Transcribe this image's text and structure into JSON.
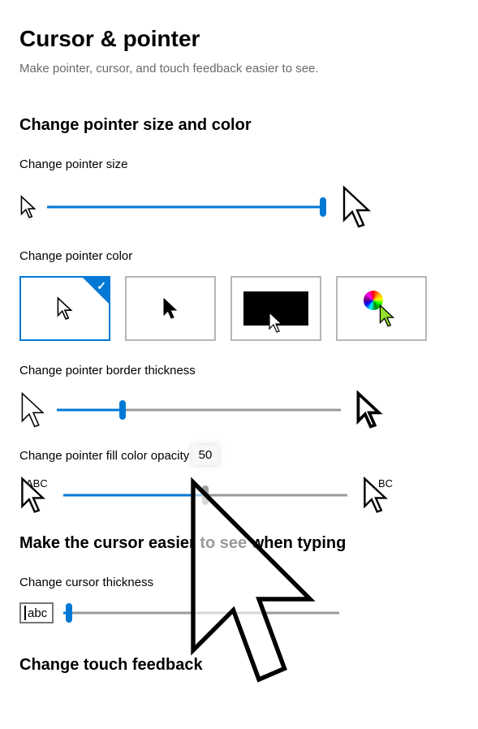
{
  "title": "Cursor & pointer",
  "subtitle": "Make pointer, cursor, and touch feedback easier to see.",
  "section_size_color": "Change pointer size and color",
  "label_pointer_size": "Change pointer size",
  "label_pointer_color": "Change pointer color",
  "label_border_thickness": "Change pointer border thickness",
  "label_fill_opacity": "Change pointer fill color opacity",
  "section_cursor": "Make the cursor easier to see when typing",
  "label_cursor_thickness": "Change cursor thickness",
  "abc_sample": "abc",
  "section_touch": "Change touch feedback",
  "opacity_tooltip": "50",
  "abc_left": "ABC",
  "abc_right": "BC",
  "sliders": {
    "pointer_size_pct": 100,
    "border_thickness_pct": 23,
    "fill_opacity_pct": 50,
    "cursor_thickness_pct": 2
  },
  "color_options": {
    "selected_index": 0
  }
}
